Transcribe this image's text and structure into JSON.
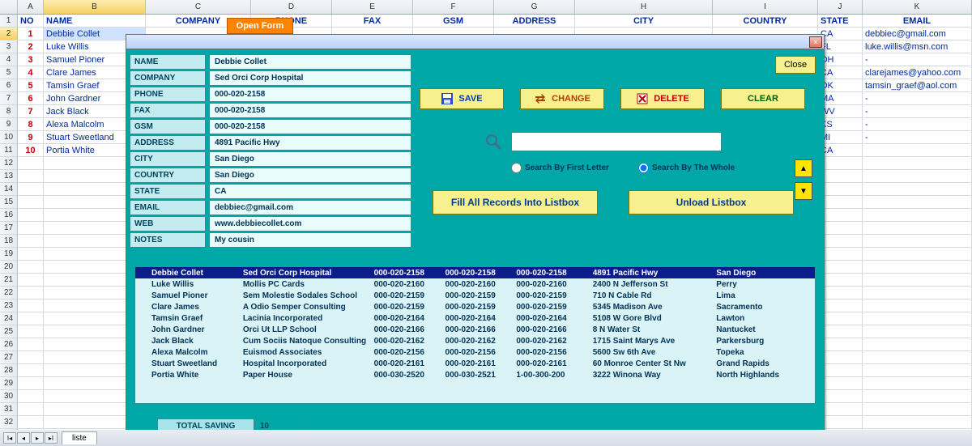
{
  "spreadsheet": {
    "columns": [
      "",
      "A",
      "B",
      "C",
      "D",
      "E",
      "F",
      "G",
      "H",
      "I",
      "J",
      "K"
    ],
    "headers": {
      "no": "NO",
      "name": "NAME",
      "company": "COMPANY",
      "phone": "PHONE",
      "fax": "FAX",
      "gsm": "GSM",
      "address": "ADDRESS",
      "city": "CITY",
      "country": "COUNTRY",
      "state": "STATE",
      "email": "EMAIL"
    },
    "open_form": "Open Form",
    "rows": [
      {
        "no": "1",
        "name": "Debbie Collet",
        "state": "CA",
        "email": "debbiec@gmail.com",
        "sel": true
      },
      {
        "no": "2",
        "name": "Luke Willis",
        "state": "FL",
        "email": "luke.willis@msn.com"
      },
      {
        "no": "3",
        "name": "Samuel Pioner",
        "state": "OH",
        "email": "-"
      },
      {
        "no": "4",
        "name": "Clare James",
        "state": "CA",
        "email": "clarejames@yahoo.com"
      },
      {
        "no": "5",
        "name": "Tamsin Graef",
        "state": "OK",
        "email": "tamsin_graef@aol.com"
      },
      {
        "no": "6",
        "name": "John Gardner",
        "state": "MA",
        "email": "-"
      },
      {
        "no": "7",
        "name": "Jack Black",
        "state": "WV",
        "email": "-"
      },
      {
        "no": "8",
        "name": "Alexa Malcolm",
        "state": "KS",
        "email": "-"
      },
      {
        "no": "9",
        "name": "Stuart Sweetland",
        "state": "MI",
        "email": "-"
      },
      {
        "no": "10",
        "name": "Portia White",
        "state": "CA",
        "email": ""
      }
    ],
    "sheet_name": "liste"
  },
  "form": {
    "close_x": "×",
    "close_btn": "Close",
    "labels": {
      "name": "NAME",
      "company": "COMPANY",
      "phone": "PHONE",
      "fax": "FAX",
      "gsm": "GSM",
      "address": "ADDRESS",
      "city": "CITY",
      "country": "COUNTRY",
      "state": "STATE",
      "email": "EMAIL",
      "web": "WEB",
      "notes": "NOTES"
    },
    "values": {
      "name": "Debbie Collet",
      "company": "Sed Orci Corp Hospital",
      "phone": "000-020-2158",
      "fax": "000-020-2158",
      "gsm": "000-020-2158",
      "address": "4891 Pacific Hwy",
      "city": "San Diego",
      "country": "San Diego",
      "state": "CA",
      "email": "debbiec@gmail.com",
      "web": "www.debbiecollet.com",
      "notes": "My cousin"
    },
    "actions": {
      "save": "SAVE",
      "change": "CHANGE",
      "delete": "DELETE",
      "clear": "CLEAR"
    },
    "search": {
      "by_first": "Search By First Letter",
      "by_whole": "Search By The Whole"
    },
    "fill": "Fill All Records Into Listbox",
    "unload": "Unload Listbox",
    "total_label": "TOTAL SAVING",
    "total_value": "10",
    "listbox": [
      {
        "name": "Debbie Collet",
        "comp": "Sed Orci Corp Hospital",
        "p1": "000-020-2158",
        "p2": "000-020-2158",
        "p3": "000-020-2158",
        "addr": "4891 Pacific Hwy",
        "city": "San Diego",
        "sel": true
      },
      {
        "name": "Luke Willis",
        "comp": "Mollis PC Cards",
        "p1": "000-020-2160",
        "p2": "000-020-2160",
        "p3": "000-020-2160",
        "addr": "2400 N Jefferson St",
        "city": "Perry"
      },
      {
        "name": "Samuel Pioner",
        "comp": "Sem Molestie Sodales School",
        "p1": "000-020-2159",
        "p2": "000-020-2159",
        "p3": "000-020-2159",
        "addr": "710 N Cable Rd",
        "city": "Lima"
      },
      {
        "name": "Clare James",
        "comp": "A Odio Semper Consulting",
        "p1": "000-020-2159",
        "p2": "000-020-2159",
        "p3": "000-020-2159",
        "addr": "5345 Madison Ave",
        "city": "Sacramento"
      },
      {
        "name": "Tamsin Graef",
        "comp": "Lacinia  Incorporated",
        "p1": "000-020-2164",
        "p2": "000-020-2164",
        "p3": "000-020-2164",
        "addr": "5108 W Gore Blvd",
        "city": "Lawton"
      },
      {
        "name": "John Gardner",
        "comp": "Orci Ut LLP School",
        "p1": "000-020-2166",
        "p2": "000-020-2166",
        "p3": "000-020-2166",
        "addr": "8 N Water St",
        "city": "Nantucket"
      },
      {
        "name": "Jack Black",
        "comp": "Cum Sociis Natoque Consulting",
        "p1": "000-020-2162",
        "p2": "000-020-2162",
        "p3": "000-020-2162",
        "addr": "1715 Saint Marys Ave",
        "city": "Parkersburg"
      },
      {
        "name": "Alexa Malcolm",
        "comp": "Euismod Associates",
        "p1": "000-020-2156",
        "p2": "000-020-2156",
        "p3": "000-020-2156",
        "addr": "5600 Sw 6th Ave",
        "city": "Topeka"
      },
      {
        "name": "Stuart Sweetland",
        "comp": " Hospital Incorporated",
        "p1": "000-020-2161",
        "p2": "000-020-2161",
        "p3": "000-020-2161",
        "addr": "60 Monroe Center St Nw",
        "city": "Grand Rapids"
      },
      {
        "name": "Portia White",
        "comp": "Paper House",
        "p1": "000-030-2520",
        "p2": "000-030-2521",
        "p3": "1-00-300-200",
        "addr": "3222 Winona Way",
        "city": "North Highlands"
      }
    ]
  }
}
